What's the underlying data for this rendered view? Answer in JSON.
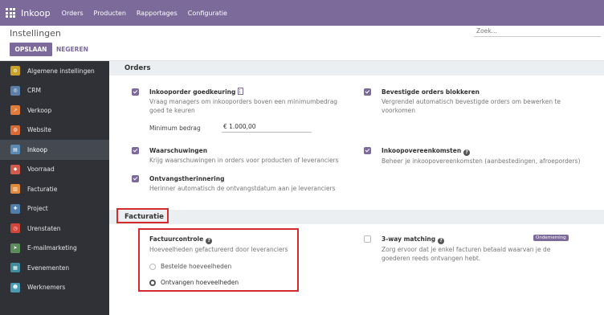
{
  "topbar": {
    "brand": "Inkoop",
    "menus": [
      "Orders",
      "Producten",
      "Rapportages",
      "Configuratie"
    ]
  },
  "control_panel": {
    "title": "Instellingen",
    "search_placeholder": "Zoek...",
    "save_label": "OPSLAAN",
    "discard_label": "NEGEREN"
  },
  "sidebar": {
    "items": [
      {
        "label": "Algemene instellingen",
        "icon": "gear-icon",
        "color": "#c9a227"
      },
      {
        "label": "CRM",
        "icon": "crm-icon",
        "color": "#5a7fa8"
      },
      {
        "label": "Verkoop",
        "icon": "sales-chart-icon",
        "color": "#e07b39"
      },
      {
        "label": "Website",
        "icon": "globe-icon",
        "color": "#d96a36"
      },
      {
        "label": "Inkoop",
        "icon": "purchase-icon",
        "color": "#5a8bb5"
      },
      {
        "label": "Voorraad",
        "icon": "boxes-icon",
        "color": "#d15a4a"
      },
      {
        "label": "Facturatie",
        "icon": "invoice-icon",
        "color": "#e08a3a"
      },
      {
        "label": "Project",
        "icon": "puzzle-icon",
        "color": "#4f7dac"
      },
      {
        "label": "Urenstaten",
        "icon": "stopwatch-icon",
        "color": "#d1453b"
      },
      {
        "label": "E-mailmarketing",
        "icon": "paper-plane-icon",
        "color": "#5b8d5b"
      },
      {
        "label": "Evenementen",
        "icon": "calendar-icon",
        "color": "#3f8ea0"
      },
      {
        "label": "Werknemers",
        "icon": "people-icon",
        "color": "#4a9bb2"
      }
    ],
    "active_index": 4
  },
  "orders": {
    "header": "Orders",
    "approval": {
      "title": "Inkooporder goedkeuring",
      "desc": "Vraag managers om inkooporders boven een minimumbedrag goed te keuren",
      "min_label": "Minimum bedrag",
      "min_value": "€ 1.000,00",
      "checked": true
    },
    "lock": {
      "title": "Bevestigde orders blokkeren",
      "desc": "Vergrendel automatisch bevestigde orders om bewerken te voorkomen",
      "checked": true
    },
    "warnings": {
      "title": "Waarschuwingen",
      "desc": "Krijg waarschuwingen in orders voor producten of leveranciers",
      "checked": true
    },
    "agreements": {
      "title": "Inkoopovereenkomsten",
      "desc": "Beheer je inkoopovereenkomsten (aanbestedingen, afroeporders)",
      "checked": true
    },
    "receipt": {
      "title": "Ontvangstherinnering",
      "desc": "Herinner automatisch de ontvangstdatum aan je leveranciers",
      "checked": true
    }
  },
  "invoicing": {
    "header": "Facturatie",
    "control": {
      "title": "Factuurcontrole",
      "desc": "Hoeveelheden gefactureerd door leveranciers",
      "options": [
        "Bestelde hoeveelheden",
        "Ontvangen hoeveelheden"
      ],
      "selected_index": 1
    },
    "three_way": {
      "title": "3-way matching",
      "badge": "Onderneming",
      "desc": "Zorg ervoor dat je enkel facturen betaald waarvan je de goederen reeds ontvangen hebt.",
      "checked": false
    }
  },
  "colors": {
    "brand": "#7c6a9a",
    "highlight_box": "#d62b2b"
  }
}
